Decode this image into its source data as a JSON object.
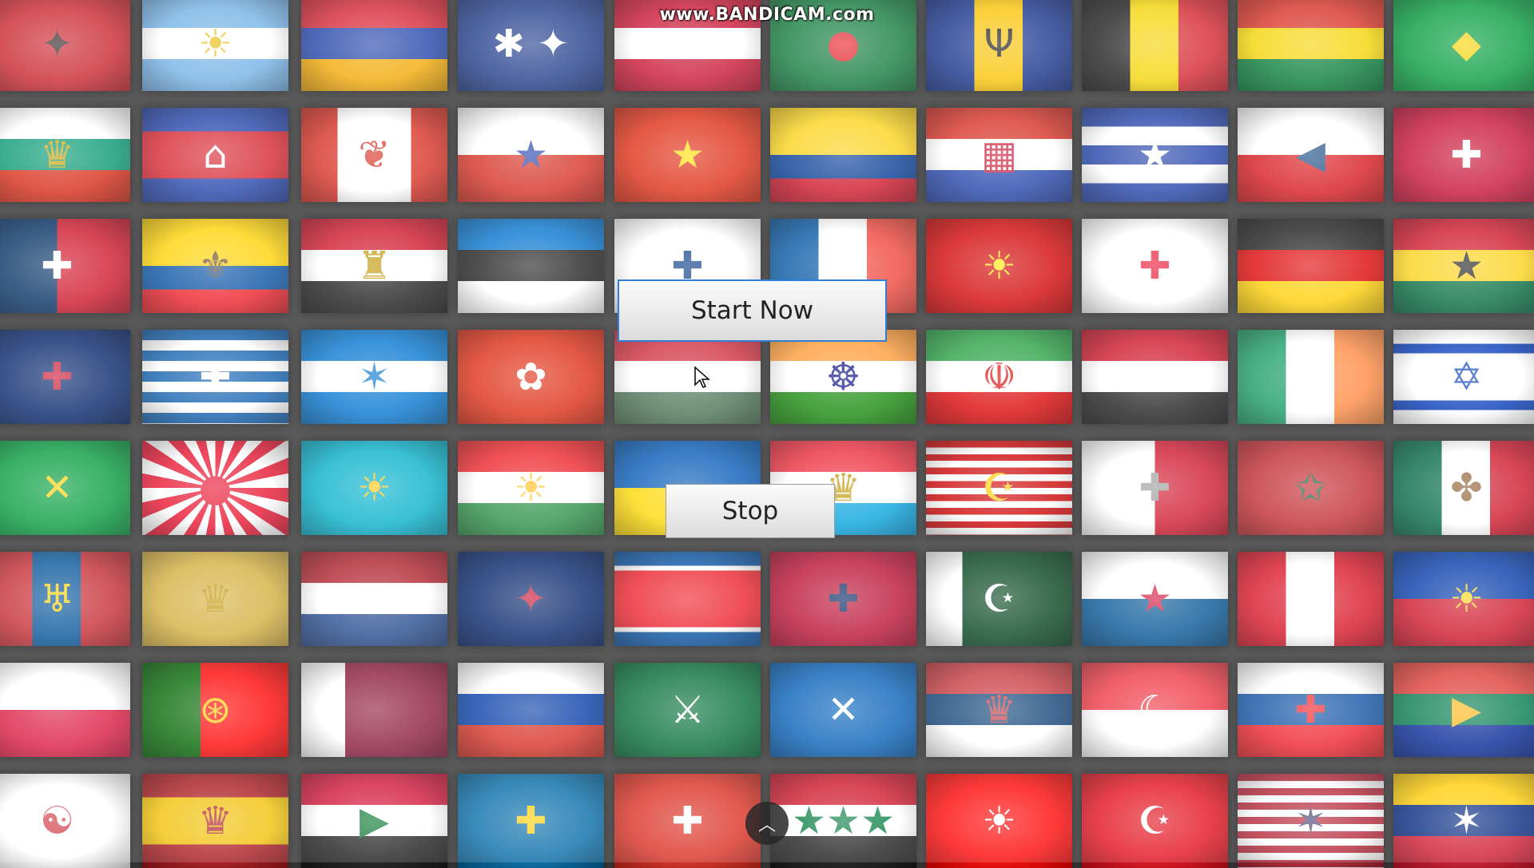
{
  "watermark": "www.BANDICAM.com",
  "buttons": {
    "start": "Start Now",
    "stop": "Stop"
  },
  "scroll_top_icon": "chevron-up-icon",
  "flags": [
    {
      "name": "albania",
      "bg": "#c9202a",
      "emblem": "✦",
      "emblemColor": "#2a1a1a"
    },
    {
      "name": "argentina",
      "bg": "linear-gradient(#6fb0e6 33%,#ffffff 33% 66%,#6fb0e6 66%)",
      "emblem": "☀",
      "emblemColor": "#e8b800"
    },
    {
      "name": "armenia",
      "bg": "linear-gradient(#d52030 33%,#1f3fa8 33% 66%,#f2a800 66%)",
      "emblem": "",
      "emblemColor": "#fff"
    },
    {
      "name": "australia",
      "bg": "#1d3a8a",
      "emblem": "✱ ✦",
      "emblemColor": "#fff"
    },
    {
      "name": "austria",
      "bg": "linear-gradient(#c8102e 33%,#ffffff 33% 66%,#c8102e 66%)",
      "emblem": "",
      "emblemColor": "#fff"
    },
    {
      "name": "bangladesh",
      "bg": "#0f7a3a",
      "emblem": "●",
      "emblemColor": "#e41b23"
    },
    {
      "name": "barbados",
      "bg": "linear-gradient(90deg,#13308a 33%,#f8c200 33% 66%,#13308a 66%)",
      "emblem": "Ψ",
      "emblemColor": "#111"
    },
    {
      "name": "belgium",
      "bg": "linear-gradient(90deg,#1a1a1a 33%,#f5d300 33% 66%,#d6202c 66%)",
      "emblem": "",
      "emblemColor": "#fff"
    },
    {
      "name": "bolivia",
      "bg": "linear-gradient(#d52b1e 33%,#f5d300 33% 66%,#007a33 66%)",
      "emblem": "",
      "emblemColor": "#fff"
    },
    {
      "name": "brazil",
      "bg": "#009b3a",
      "emblem": "◆",
      "emblemColor": "#f5d300"
    },
    {
      "name": "bulgaria",
      "bg": "linear-gradient(#ffffff 33%,#00966e 33% 66%,#d62612 66%)",
      "emblem": "♛",
      "emblemColor": "#c9a000"
    },
    {
      "name": "cambodia",
      "bg": "linear-gradient(#1f3fa8 25%,#d6202c 25% 75%,#1f3fa8 75%)",
      "emblem": "⌂",
      "emblemColor": "#fff"
    },
    {
      "name": "canada",
      "bg": "linear-gradient(90deg,#d52b1e 25%,#ffffff 25% 75%,#d52b1e 75%)",
      "emblem": "❦",
      "emblemColor": "#d52b1e"
    },
    {
      "name": "chile",
      "bg": "linear-gradient(#ffffff 50%,#d52b1e 50%)",
      "emblem": "★",
      "emblemColor": "#1f3fa8"
    },
    {
      "name": "china",
      "bg": "#de2910",
      "emblem": "★",
      "emblemColor": "#ffde00"
    },
    {
      "name": "colombia",
      "bg": "linear-gradient(#fcd116 50%,#003893 50% 75%,#ce1126 75%)",
      "emblem": "",
      "emblemColor": "#fff"
    },
    {
      "name": "croatia",
      "bg": "linear-gradient(#d52b1e 33%,#ffffff 33% 66%,#1f3fa8 66%)",
      "emblem": "▦",
      "emblemColor": "#c8102e"
    },
    {
      "name": "cuba",
      "bg": "repeating-linear-gradient(#1f3fa8 0 23.6px,#ffffff 23.6px 47.2px)",
      "emblem": "★",
      "emblemColor": "#fff"
    },
    {
      "name": "czech",
      "bg": "linear-gradient(#ffffff 50%,#d7141a 50%)",
      "emblem": "◀",
      "emblemColor": "#11457e"
    },
    {
      "name": "denmark",
      "bg": "#c60c30",
      "emblem": "✚",
      "emblemColor": "#fff"
    },
    {
      "name": "dominican",
      "bg": "linear-gradient(90deg,#002d62 50%,#ce1126 50%)",
      "emblem": "✚",
      "emblemColor": "#fff"
    },
    {
      "name": "ecuador",
      "bg": "linear-gradient(#ffd100 50%,#034ea2 50% 75%,#ed1c24 75%)",
      "emblem": "⚜",
      "emblemColor": "#6b4a1f"
    },
    {
      "name": "egypt",
      "bg": "linear-gradient(#ce1126 33%,#ffffff 33% 66%,#1a1a1a 66%)",
      "emblem": "♜",
      "emblemColor": "#c09300"
    },
    {
      "name": "estonia",
      "bg": "linear-gradient(#0072ce 33%,#1a1a1a 33% 66%,#ffffff 66%)",
      "emblem": "",
      "emblemColor": "#fff"
    },
    {
      "name": "finland",
      "bg": "#ffffff",
      "emblem": "✚",
      "emblemColor": "#003580"
    },
    {
      "name": "france",
      "bg": "linear-gradient(90deg,#0055a4 33%,#ffffff 33% 66%,#ef4135 66%)",
      "emblem": "",
      "emblemColor": "#fff"
    },
    {
      "name": "macedonia",
      "bg": "#d20000",
      "emblem": "☀",
      "emblemColor": "#ffe600"
    },
    {
      "name": "georgia",
      "bg": "#ffffff",
      "emblem": "✚",
      "emblemColor": "#e8112d"
    },
    {
      "name": "germany",
      "bg": "linear-gradient(#1a1a1a 33%,#dd0000 33% 66%,#ffce00 66%)",
      "emblem": "",
      "emblemColor": "#fff"
    },
    {
      "name": "ghana",
      "bg": "linear-gradient(#ce1126 33%,#fcd116 33% 66%,#006b3f 66%)",
      "emblem": "★",
      "emblemColor": "#1a1a1a"
    },
    {
      "name": "uk",
      "bg": "#012169",
      "emblem": "✚",
      "emblemColor": "#c8102e"
    },
    {
      "name": "greece",
      "bg": "repeating-linear-gradient(#0d5eaf 0 13px,#ffffff 13px 26px)",
      "emblem": "✚",
      "emblemColor": "#fff"
    },
    {
      "name": "honduras",
      "bg": "linear-gradient(#0073cf 33%,#ffffff 33% 66%,#0073cf 66%)",
      "emblem": "✶",
      "emblemColor": "#0073cf"
    },
    {
      "name": "hong-kong",
      "bg": "#de2910",
      "emblem": "✿",
      "emblemColor": "#fff"
    },
    {
      "name": "hungary",
      "bg": "linear-gradient(#ce2939 33%,#ffffff 33% 66%,#477050 66%)",
      "emblem": "",
      "emblemColor": "#fff"
    },
    {
      "name": "india",
      "bg": "linear-gradient(#ff9933 33%,#ffffff 33% 66%,#138808 66%)",
      "emblem": "☸",
      "emblemColor": "#000080"
    },
    {
      "name": "iran",
      "bg": "linear-gradient(#239f40 33%,#ffffff 33% 66%,#da0000 66%)",
      "emblem": "☫",
      "emblemColor": "#da0000"
    },
    {
      "name": "iraq",
      "bg": "linear-gradient(#ce1126 33%,#ffffff 33% 66%,#1a1a1a 66%)",
      "emblem": "",
      "emblemColor": "#007a3d"
    },
    {
      "name": "ireland",
      "bg": "linear-gradient(90deg,#169b62 33%,#ffffff 33% 66%,#ff883e 66%)",
      "emblem": "",
      "emblemColor": "#fff"
    },
    {
      "name": "israel",
      "bg": "linear-gradient(#ffffff 15%,#0038b8 15% 25%,#ffffff 25% 75%,#0038b8 75% 85%,#ffffff 85%)",
      "emblem": "✡",
      "emblemColor": "#0038b8"
    },
    {
      "name": "jamaica",
      "bg": "#009b3a",
      "emblem": "✕",
      "emblemColor": "#fed100"
    },
    {
      "name": "rising-sun",
      "bg": "repeating-conic-gradient(from 0deg at 50% 50%,#e8102c 0 11.25deg,#ffffff 11.25deg 22.5deg)",
      "emblem": "●",
      "emblemColor": "#e8102c"
    },
    {
      "name": "kazakhstan",
      "bg": "#00afca",
      "emblem": "☀",
      "emblemColor": "#fec50c"
    },
    {
      "name": "kurdistan",
      "bg": "linear-gradient(#ed2024 33%,#ffffff 33% 66%,#278e43 66%)",
      "emblem": "☀",
      "emblemColor": "#febd11"
    },
    {
      "name": "ukraine",
      "bg": "linear-gradient(#0057b7 50%,#ffd700 50%)",
      "emblem": "",
      "emblemColor": "#fff"
    },
    {
      "name": "luxembourg",
      "bg": "linear-gradient(#ed2939 33%,#ffffff 33% 66%,#00a1de 66%)",
      "emblem": "♛",
      "emblemColor": "#c09300"
    },
    {
      "name": "malaysia",
      "bg": "repeating-linear-gradient(#cc0001 0 8.4px,#ffffff 8.4px 16.8px)",
      "emblem": "☪",
      "emblemColor": "#ffcc00"
    },
    {
      "name": "malta-pattern",
      "bg": "linear-gradient(90deg,#ffffff 50%,#cf142b 50%)",
      "emblem": "✚",
      "emblemColor": "#999"
    },
    {
      "name": "morocco",
      "bg": "#c1272d",
      "emblem": "✩",
      "emblemColor": "#006233"
    },
    {
      "name": "mexico",
      "bg": "linear-gradient(90deg,#006847 33%,#ffffff 33% 66%,#ce1126 66%)",
      "emblem": "✤",
      "emblemColor": "#8a5a2b"
    },
    {
      "name": "mongolia",
      "bg": "linear-gradient(90deg,#c4272f 33%,#015197 33% 66%,#c4272f 66%)",
      "emblem": "♅",
      "emblemColor": "#f9cf02"
    },
    {
      "name": "montenegro",
      "bg": "#d3ae3b",
      "emblem": "♛",
      "emblemColor": "#c09300"
    },
    {
      "name": "netherlands",
      "bg": "linear-gradient(#ae1c28 33%,#ffffff 33% 66%,#21468b 66%)",
      "emblem": "",
      "emblemColor": "#fff"
    },
    {
      "name": "new-zealand",
      "bg": "#012169",
      "emblem": "✦",
      "emblemColor": "#c8102e"
    },
    {
      "name": "north-korea",
      "bg": "linear-gradient(#024fa2 15%,#ffffff 15% 20%,#ed1c27 20% 80%,#ffffff 80% 85%,#024fa2 85%)",
      "emblem": "★",
      "emblemColor": "#ed1c27"
    },
    {
      "name": "norway",
      "bg": "#ba0c2f",
      "emblem": "✚",
      "emblemColor": "#00205b"
    },
    {
      "name": "pakistan",
      "bg": "linear-gradient(90deg,#ffffff 25%,#01411c 25%)",
      "emblem": "☪",
      "emblemColor": "#fff"
    },
    {
      "name": "panama",
      "bg": "linear-gradient(#ffffff 50%,#005293 50%)",
      "emblem": "★",
      "emblemColor": "#d21034"
    },
    {
      "name": "peru",
      "bg": "linear-gradient(90deg,#d91023 33%,#ffffff 33% 66%,#d91023 66%)",
      "emblem": "",
      "emblemColor": "#fff"
    },
    {
      "name": "philippines",
      "bg": "linear-gradient(#0038a8 50%,#ce1126 50%)",
      "emblem": "☀",
      "emblemColor": "#fcd116"
    },
    {
      "name": "poland",
      "bg": "linear-gradient(#ffffff 50%,#dc143c 50%)",
      "emblem": "",
      "emblemColor": "#fff"
    },
    {
      "name": "portugal",
      "bg": "linear-gradient(90deg,#006600 40%,#ff0000 40%)",
      "emblem": "⊛",
      "emblemColor": "#ffcc00"
    },
    {
      "name": "qatar",
      "bg": "linear-gradient(90deg,#ffffff 30%,#8a1538 30%)",
      "emblem": "",
      "emblemColor": "#fff"
    },
    {
      "name": "russia",
      "bg": "linear-gradient(#ffffff 33%,#0039a6 33% 66%,#d52b1e 66%)",
      "emblem": "",
      "emblemColor": "#fff"
    },
    {
      "name": "saudi-arabia",
      "bg": "#006c35",
      "emblem": "⚔",
      "emblemColor": "#fff"
    },
    {
      "name": "scotland",
      "bg": "#005eb8",
      "emblem": "✕",
      "emblemColor": "#fff"
    },
    {
      "name": "serbia",
      "bg": "linear-gradient(#c6363c 33%,#0c4076 33% 66%,#ffffff 66%)",
      "emblem": "♛",
      "emblemColor": "#c6363c"
    },
    {
      "name": "singapore",
      "bg": "linear-gradient(#ef3340 50%,#ffffff 50%)",
      "emblem": "☾",
      "emblemColor": "#fff"
    },
    {
      "name": "slovakia",
      "bg": "linear-gradient(#ffffff 33%,#0b4ea2 33% 66%,#ee1c25 66%)",
      "emblem": "✚",
      "emblemColor": "#ee1c25"
    },
    {
      "name": "south-africa",
      "bg": "linear-gradient(#de3831 33%,#007a4d 33% 66%,#002395 66%)",
      "emblem": "▶",
      "emblemColor": "#ffb612"
    },
    {
      "name": "south-korea",
      "bg": "#ffffff",
      "emblem": "☯",
      "emblemColor": "#cd2e3a"
    },
    {
      "name": "spain",
      "bg": "linear-gradient(#aa151b 25%,#f1bf00 25% 75%,#aa151b 75%)",
      "emblem": "♛",
      "emblemColor": "#aa151b"
    },
    {
      "name": "sudan",
      "bg": "linear-gradient(#d21034 33%,#ffffff 33% 66%,#1a1a1a 66%)",
      "emblem": "▶",
      "emblemColor": "#007229"
    },
    {
      "name": "sweden",
      "bg": "#006aa7",
      "emblem": "✚",
      "emblemColor": "#fecc00"
    },
    {
      "name": "switzerland",
      "bg": "#da291c",
      "emblem": "✚",
      "emblemColor": "#fff"
    },
    {
      "name": "syria",
      "bg": "linear-gradient(#ce1126 33%,#ffffff 33% 66%,#1a1a1a 66%)",
      "emblem": "★★★",
      "emblemColor": "#007a3d"
    },
    {
      "name": "taiwan",
      "bg": "#fe0000",
      "emblem": "☀",
      "emblemColor": "#fff"
    },
    {
      "name": "turkey",
      "bg": "#e30a17",
      "emblem": "☪",
      "emblemColor": "#fff"
    },
    {
      "name": "usa",
      "bg": "repeating-linear-gradient(#b22234 0 9px,#ffffff 9px 18px)",
      "emblem": "✶",
      "emblemColor": "#3c3b6e"
    },
    {
      "name": "venezuela",
      "bg": "linear-gradient(#ffcc00 33%,#00247d 33% 66%,#cf142b 66%)",
      "emblem": "✶",
      "emblemColor": "#fff"
    }
  ]
}
